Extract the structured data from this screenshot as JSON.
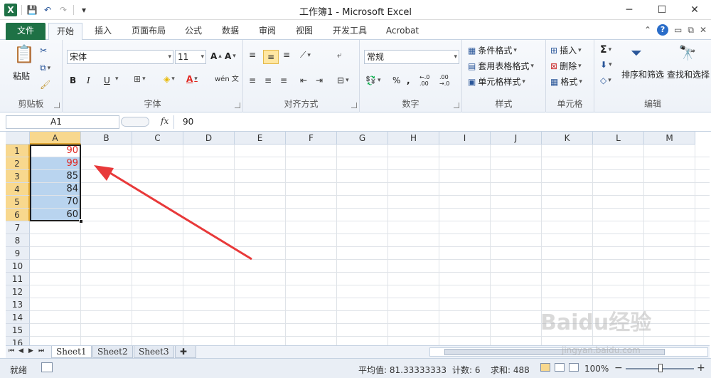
{
  "window": {
    "title": "工作簿1 - Microsoft Excel",
    "minimize": "─",
    "maximize": "☐",
    "close": "✕"
  },
  "qat": {
    "save": "💾",
    "undo": "↶",
    "redo": "↷",
    "customize": "▾"
  },
  "tabs": {
    "file": "文件",
    "items": [
      "开始",
      "插入",
      "页面布局",
      "公式",
      "数据",
      "审阅",
      "视图",
      "开发工具",
      "Acrobat"
    ]
  },
  "ribbon": {
    "clipboard": {
      "paste": "粘贴",
      "label": "剪贴板"
    },
    "font": {
      "family": "宋体",
      "size": "11",
      "bold": "B",
      "italic": "I",
      "underline": "U",
      "label": "字体",
      "wen": "wén 文"
    },
    "alignment": {
      "label": "对齐方式"
    },
    "number": {
      "format": "常规",
      "label": "数字",
      "percent": "%",
      "comma": ",",
      "inc": "←.0 .00",
      "dec": ".00 →.0"
    },
    "styles": {
      "conditional": "条件格式",
      "table": "套用表格格式",
      "cell": "单元格样式",
      "label": "样式"
    },
    "cells": {
      "insert": "插入",
      "delete": "删除",
      "format": "格式",
      "label": "单元格"
    },
    "editing": {
      "sigma": "Σ",
      "sort": "排序和筛选",
      "find": "查找和选择",
      "label": "编辑"
    }
  },
  "formula_bar": {
    "name_box": "A1",
    "fx": "fx",
    "value": "90"
  },
  "columns": [
    "A",
    "B",
    "C",
    "D",
    "E",
    "F",
    "G",
    "H",
    "I",
    "J",
    "K",
    "L",
    "M"
  ],
  "rows": [
    "1",
    "2",
    "3",
    "4",
    "5",
    "6",
    "7",
    "8",
    "9",
    "10",
    "11",
    "12",
    "13",
    "14",
    "15",
    "16"
  ],
  "cells_a": [
    "90",
    "99",
    "85",
    "84",
    "70",
    "60"
  ],
  "colors": {
    "red_value": "#e0251e",
    "selection": "#b9d4ef",
    "header_selected": "#f8d88e",
    "file_tab": "#1e7145",
    "arrow": "#e8393a"
  },
  "sheets": [
    "Sheet1",
    "Sheet2",
    "Sheet3"
  ],
  "status": {
    "mode": "就绪",
    "average": "平均值: 81.33333333",
    "count": "计数: 6",
    "sum": "求和: 488",
    "zoom": "100%",
    "zoom_minus": "−",
    "zoom_plus": "+"
  },
  "watermark": {
    "text": "Baidu经验",
    "sub": "jingyan.baidu.com"
  }
}
